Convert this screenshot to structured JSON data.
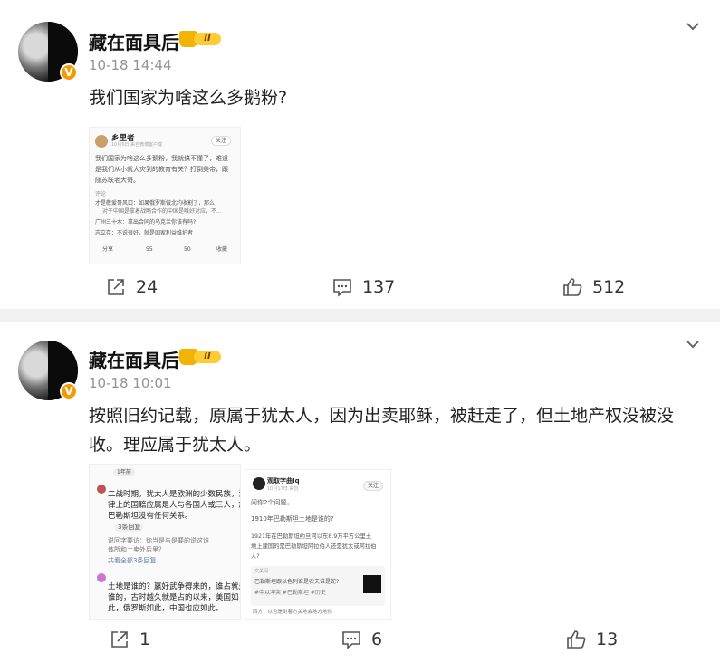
{
  "posts": [
    {
      "author": "藏在面具后",
      "level": "II",
      "verified_badge": "V",
      "time": "10-18 14:44",
      "text": "我们国家为啥这么多鹅粉?",
      "shares": "24",
      "comments": "137",
      "likes": "512",
      "embedded": {
        "author": "乡里者",
        "subtitle": "10月6日  来自微博客户端",
        "follow": "关注",
        "body_line1": "我们国家为啥这么多鹅粉，我就搞不懂了，难道",
        "body_line2": "是我们从小就大灾到的教育有关？打倒美帝，跟",
        "body_line3": "随苏联老大哥。",
        "comments_label": "评论",
        "c1": "才是敬爱哥风口：如果俄罗斯做北约收割了，那么",
        "c1b": "对于中国是拿着战略合作的中国是唯好对应，不...",
        "c2": "广州三十木：拿出合同的乌克兰你该有吗?",
        "c3": "志立存：不说很好，就是国家利益维护者",
        "share": "分享",
        "comment_count": "55",
        "like_count": "50",
        "fav": "收藏"
      }
    },
    {
      "author": "藏在面具后",
      "level": "II",
      "verified_badge": "V",
      "time": "10-18 10:01",
      "text": "按照旧约记载，原属于犹太人，因为出卖耶稣，被赶走了，但土地产权没被没收。理应属于犹太人。",
      "shares": "1",
      "comments": "6",
      "likes": "13",
      "embedded_left": {
        "tag": "1年前",
        "l1": "二战时期，犹太人是欧洲的少数民族，法",
        "l2": "律上的国籍应属是人与各国人或三人，放",
        "l3": "巴勒斯坦没有任何关系。",
        "more": "3条回复",
        "r1": "说回字要访：你当是与是要的说这谁",
        "r2": "体所和土卖外后里？",
        "r3": "共看全部3条回复",
        "l4": "土地是谁的？赢好武争得来的，谁占就是",
        "l5": "谁的，古时越久就是占的以来，美国如",
        "l6": "此，俄罗斯如此，中国也应如此。"
      },
      "embedded_right": {
        "author": "观取字曲Iq",
        "subtitle": "10月17日  来自",
        "follow": "关注",
        "q": "问你2个问题，",
        "q1": "1910年巴勒斯坦土地是谁的?",
        "q2a": "1921年在巴勒斯坦约旦河以东8.9万平方公里土",
        "q2b": "地上建国的是巴勒斯坦阿拉伯人还是犹太或阿拉伯",
        "q2c": "人?",
        "card_label": "文关问",
        "card_t1": "巴勒斯坦跟以色列谁是农夫谁是蛇?",
        "card_t2": "#中以冲突 #巴勒斯坦 #历史",
        "footer": "西方：以色是耐着方关地会地方地你"
      }
    }
  ]
}
